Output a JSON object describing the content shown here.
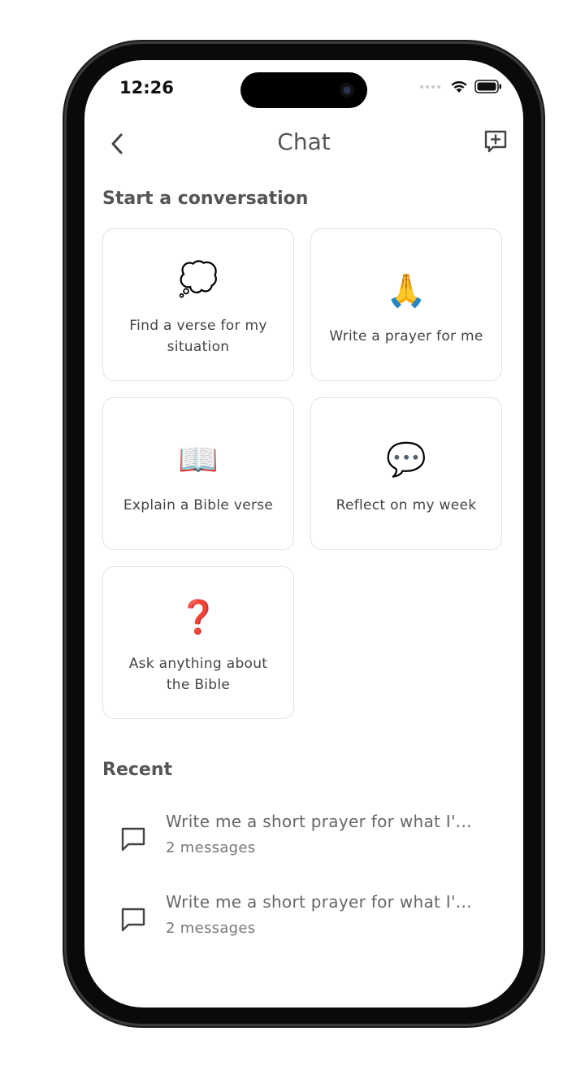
{
  "status_bar": {
    "time": "12:26"
  },
  "nav": {
    "title": "Chat"
  },
  "start_section": {
    "title": "Start a conversation"
  },
  "cards": [
    {
      "emoji": "💭",
      "label": "Find a verse for my situation"
    },
    {
      "emoji": "🙏",
      "label": "Write a prayer for me"
    },
    {
      "emoji": "📖",
      "label": "Explain a Bible verse"
    },
    {
      "emoji": "💬",
      "label": "Reflect on my week"
    },
    {
      "emoji": "❓",
      "label": "Ask anything about the Bible"
    }
  ],
  "recent": {
    "title": "Recent",
    "items": [
      {
        "title": "Write me a short prayer for what I'...",
        "subtitle": "2 messages"
      },
      {
        "title": "Write me a short prayer for what I'...",
        "subtitle": "2 messages"
      }
    ]
  },
  "icons": {
    "back": "chevron-left-icon",
    "new_chat": "new-chat-icon",
    "recent_item": "chat-bubble-icon",
    "wifi": "wifi-icon",
    "battery": "battery-icon"
  },
  "colors": {
    "text_primary": "#555555",
    "card_border": "#e2e2e2",
    "phone_frame": "#0a0a0a"
  }
}
